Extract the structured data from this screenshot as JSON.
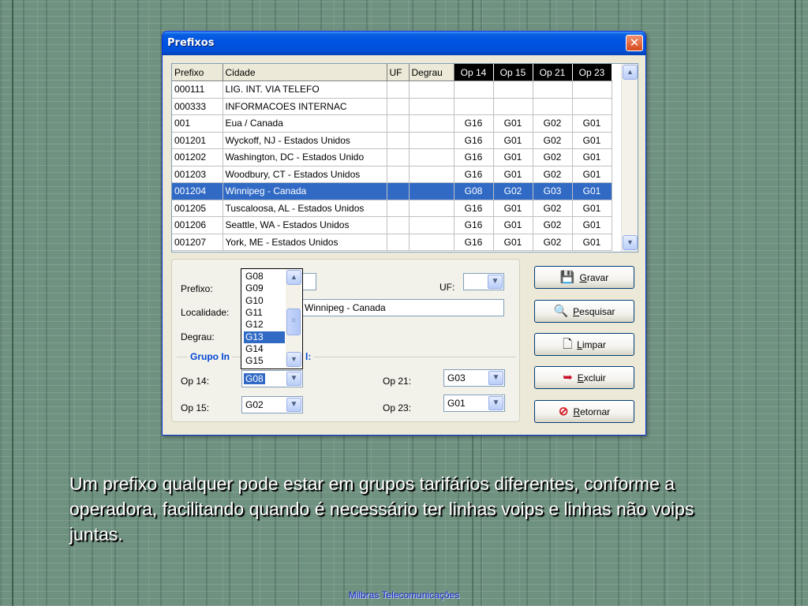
{
  "window": {
    "title": "Prefixos",
    "close_glyph": "✕"
  },
  "grid": {
    "columns": [
      "Prefixo",
      "Cidade",
      "UF",
      "Degrau",
      "Op 14",
      "Op 15",
      "Op 21",
      "Op 23"
    ],
    "rows": [
      {
        "prefixo": "000111",
        "cidade": "LIG. INT. VIA TELEFO",
        "uf": "",
        "degrau": "",
        "op14": "",
        "op15": "",
        "op21": "",
        "op23": ""
      },
      {
        "prefixo": "000333",
        "cidade": "INFORMACOES INTERNAC",
        "uf": "",
        "degrau": "",
        "op14": "",
        "op15": "",
        "op21": "",
        "op23": ""
      },
      {
        "prefixo": "001",
        "cidade": "Eua / Canada",
        "uf": "",
        "degrau": "",
        "op14": "G16",
        "op15": "G01",
        "op21": "G02",
        "op23": "G01"
      },
      {
        "prefixo": "001201",
        "cidade": "Wyckoff, NJ - Estados Unidos",
        "uf": "",
        "degrau": "",
        "op14": "G16",
        "op15": "G01",
        "op21": "G02",
        "op23": "G01"
      },
      {
        "prefixo": "001202",
        "cidade": "Washington, DC - Estados Unido",
        "uf": "",
        "degrau": "",
        "op14": "G16",
        "op15": "G01",
        "op21": "G02",
        "op23": "G01"
      },
      {
        "prefixo": "001203",
        "cidade": "Woodbury, CT - Estados Unidos",
        "uf": "",
        "degrau": "",
        "op14": "G16",
        "op15": "G01",
        "op21": "G02",
        "op23": "G01"
      },
      {
        "prefixo": "001204",
        "cidade": "Winnipeg - Canada",
        "uf": "",
        "degrau": "",
        "op14": "G08",
        "op15": "G02",
        "op21": "G03",
        "op23": "G01"
      },
      {
        "prefixo": "001205",
        "cidade": "Tuscaloosa, AL - Estados Unidos",
        "uf": "",
        "degrau": "",
        "op14": "G16",
        "op15": "G01",
        "op21": "G02",
        "op23": "G01"
      },
      {
        "prefixo": "001206",
        "cidade": "Seattle, WA - Estados Unidos",
        "uf": "",
        "degrau": "",
        "op14": "G16",
        "op15": "G01",
        "op21": "G02",
        "op23": "G01"
      },
      {
        "prefixo": "001207",
        "cidade": "York, ME - Estados Unidos",
        "uf": "",
        "degrau": "",
        "op14": "G16",
        "op15": "G01",
        "op21": "G02",
        "op23": "G01"
      }
    ],
    "selected_index": 6,
    "scroll_up_icon": "▲",
    "scroll_down_icon": "▼"
  },
  "form": {
    "prefixo_label": "Prefixo:",
    "prefixo_value": "",
    "uf_label": "UF:",
    "uf_value": "",
    "localidade_label": "Localidade:",
    "localidade_value": "Winnipeg - Canada",
    "degrau_label": "Degrau:",
    "group_title": "Grupo In",
    "group_title_tail": "l:",
    "op14_label": "Op 14:",
    "op14_value": "G08",
    "op15_label": "Op 15:",
    "op15_value": "G02",
    "op21_label": "Op 21:",
    "op21_value": "G03",
    "op23_label": "Op 23:",
    "op23_value": "G01",
    "combo_arrow": "▼"
  },
  "dropdown": {
    "options": [
      "G08",
      "G09",
      "G10",
      "G11",
      "G12",
      "G13",
      "G14",
      "G15"
    ],
    "selected": "G13",
    "thumb_grip": "≡"
  },
  "buttons": {
    "gravar": {
      "mnemonic": "G",
      "rest": "ravar",
      "icon": "floppy-disk-icon",
      "glyph": "💾"
    },
    "pesquisar": {
      "mnemonic": "P",
      "rest": "esquisar",
      "icon": "magnifier-icon",
      "glyph": "🔍"
    },
    "limpar": {
      "mnemonic": "L",
      "rest": "impar",
      "icon": "new-document-icon",
      "glyph": "🗋"
    },
    "excluir": {
      "mnemonic": "E",
      "rest": "xcluir",
      "icon": "delete-arrow-icon",
      "glyph": "➥"
    },
    "retornar": {
      "mnemonic": "R",
      "rest": "etornar",
      "icon": "no-entry-icon",
      "glyph": "⊘"
    }
  },
  "caption": "Um prefixo qualquer pode estar em  grupos  tarifários  diferentes, conforme a operadora, facilitando quando é necessário ter linhas voips e linhas não voips juntas.",
  "footer": "Milbras Telecomunicações",
  "colors": {
    "selection": "#316ac5",
    "title_bar": "#0054e3",
    "group_title": "#0046d5",
    "footer_text": "#1a2bc8",
    "close_button": "#d64a1c"
  }
}
